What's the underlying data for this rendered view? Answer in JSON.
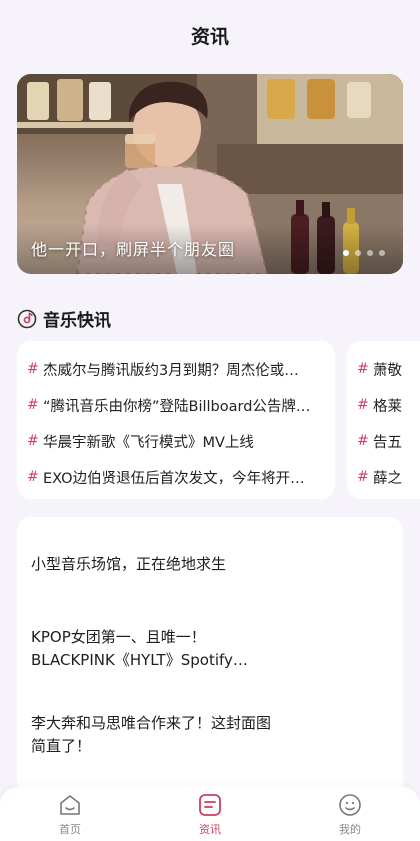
{
  "header": {
    "title": "资讯"
  },
  "banner": {
    "caption": "他一开口，刷屏半个朋友圈",
    "dots": 4,
    "active_dot": 0
  },
  "section": {
    "title": "音乐快讯",
    "icon": "music-disc-icon"
  },
  "news_primary": [
    {
      "hash": "#",
      "text": "杰威尔与腾讯版约3月到期？周杰伦或…"
    },
    {
      "hash": "#",
      "text": "“腾讯音乐由你榜”登陆Billboard公告牌…"
    },
    {
      "hash": "#",
      "text": "华晨宇新歌《飞行模式》MV上线"
    },
    {
      "hash": "#",
      "text": "EXO边伯贤退伍后首次发文，今年将开…"
    }
  ],
  "news_secondary": [
    {
      "hash": "#",
      "text": "萧敬"
    },
    {
      "hash": "#",
      "text": "格莱"
    },
    {
      "hash": "#",
      "text": "告五"
    },
    {
      "hash": "#",
      "text": "薛之"
    }
  ],
  "articles": [
    {
      "title": "小型音乐场馆，正在绝地求生"
    },
    {
      "title": "KPOP女团第一、且唯一！BLACKPINK《HYLT》Spotify…"
    },
    {
      "title": "李大奔和马思唯合作来了！这封面图简直了！"
    }
  ],
  "tabbar": {
    "tabs": [
      {
        "label": "首页",
        "icon": "home-icon"
      },
      {
        "label": "资讯",
        "icon": "news-icon"
      },
      {
        "label": "我的",
        "icon": "profile-face-icon"
      }
    ],
    "active_index": 1
  },
  "colors": {
    "accent": "#c93f5e",
    "hash": "#d0416a",
    "background": "#f6f4fa"
  }
}
